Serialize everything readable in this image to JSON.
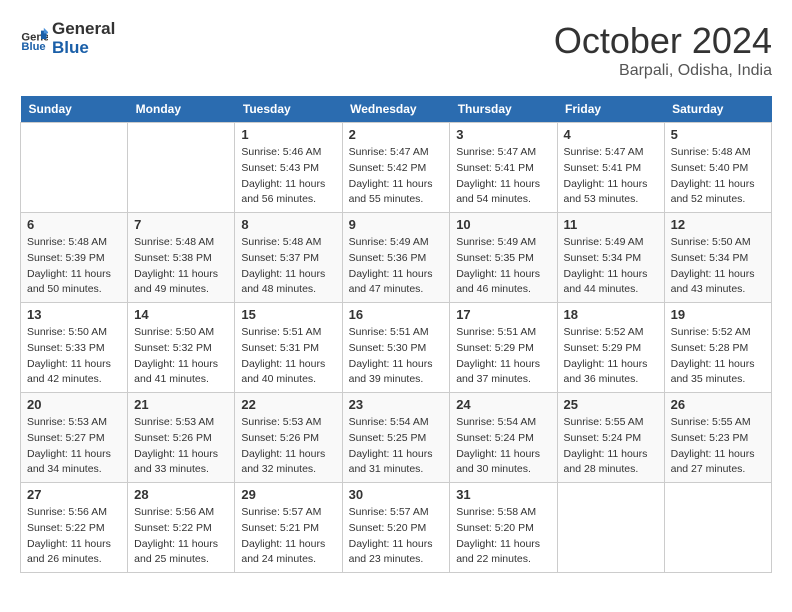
{
  "logo": {
    "line1": "General",
    "line2": "Blue"
  },
  "title": "October 2024",
  "location": "Barpali, Odisha, India",
  "days_of_week": [
    "Sunday",
    "Monday",
    "Tuesday",
    "Wednesday",
    "Thursday",
    "Friday",
    "Saturday"
  ],
  "weeks": [
    [
      {
        "day": "",
        "sunrise": "",
        "sunset": "",
        "daylight": ""
      },
      {
        "day": "",
        "sunrise": "",
        "sunset": "",
        "daylight": ""
      },
      {
        "day": "1",
        "sunrise": "Sunrise: 5:46 AM",
        "sunset": "Sunset: 5:43 PM",
        "daylight": "Daylight: 11 hours and 56 minutes."
      },
      {
        "day": "2",
        "sunrise": "Sunrise: 5:47 AM",
        "sunset": "Sunset: 5:42 PM",
        "daylight": "Daylight: 11 hours and 55 minutes."
      },
      {
        "day": "3",
        "sunrise": "Sunrise: 5:47 AM",
        "sunset": "Sunset: 5:41 PM",
        "daylight": "Daylight: 11 hours and 54 minutes."
      },
      {
        "day": "4",
        "sunrise": "Sunrise: 5:47 AM",
        "sunset": "Sunset: 5:41 PM",
        "daylight": "Daylight: 11 hours and 53 minutes."
      },
      {
        "day": "5",
        "sunrise": "Sunrise: 5:48 AM",
        "sunset": "Sunset: 5:40 PM",
        "daylight": "Daylight: 11 hours and 52 minutes."
      }
    ],
    [
      {
        "day": "6",
        "sunrise": "Sunrise: 5:48 AM",
        "sunset": "Sunset: 5:39 PM",
        "daylight": "Daylight: 11 hours and 50 minutes."
      },
      {
        "day": "7",
        "sunrise": "Sunrise: 5:48 AM",
        "sunset": "Sunset: 5:38 PM",
        "daylight": "Daylight: 11 hours and 49 minutes."
      },
      {
        "day": "8",
        "sunrise": "Sunrise: 5:48 AM",
        "sunset": "Sunset: 5:37 PM",
        "daylight": "Daylight: 11 hours and 48 minutes."
      },
      {
        "day": "9",
        "sunrise": "Sunrise: 5:49 AM",
        "sunset": "Sunset: 5:36 PM",
        "daylight": "Daylight: 11 hours and 47 minutes."
      },
      {
        "day": "10",
        "sunrise": "Sunrise: 5:49 AM",
        "sunset": "Sunset: 5:35 PM",
        "daylight": "Daylight: 11 hours and 46 minutes."
      },
      {
        "day": "11",
        "sunrise": "Sunrise: 5:49 AM",
        "sunset": "Sunset: 5:34 PM",
        "daylight": "Daylight: 11 hours and 44 minutes."
      },
      {
        "day": "12",
        "sunrise": "Sunrise: 5:50 AM",
        "sunset": "Sunset: 5:34 PM",
        "daylight": "Daylight: 11 hours and 43 minutes."
      }
    ],
    [
      {
        "day": "13",
        "sunrise": "Sunrise: 5:50 AM",
        "sunset": "Sunset: 5:33 PM",
        "daylight": "Daylight: 11 hours and 42 minutes."
      },
      {
        "day": "14",
        "sunrise": "Sunrise: 5:50 AM",
        "sunset": "Sunset: 5:32 PM",
        "daylight": "Daylight: 11 hours and 41 minutes."
      },
      {
        "day": "15",
        "sunrise": "Sunrise: 5:51 AM",
        "sunset": "Sunset: 5:31 PM",
        "daylight": "Daylight: 11 hours and 40 minutes."
      },
      {
        "day": "16",
        "sunrise": "Sunrise: 5:51 AM",
        "sunset": "Sunset: 5:30 PM",
        "daylight": "Daylight: 11 hours and 39 minutes."
      },
      {
        "day": "17",
        "sunrise": "Sunrise: 5:51 AM",
        "sunset": "Sunset: 5:29 PM",
        "daylight": "Daylight: 11 hours and 37 minutes."
      },
      {
        "day": "18",
        "sunrise": "Sunrise: 5:52 AM",
        "sunset": "Sunset: 5:29 PM",
        "daylight": "Daylight: 11 hours and 36 minutes."
      },
      {
        "day": "19",
        "sunrise": "Sunrise: 5:52 AM",
        "sunset": "Sunset: 5:28 PM",
        "daylight": "Daylight: 11 hours and 35 minutes."
      }
    ],
    [
      {
        "day": "20",
        "sunrise": "Sunrise: 5:53 AM",
        "sunset": "Sunset: 5:27 PM",
        "daylight": "Daylight: 11 hours and 34 minutes."
      },
      {
        "day": "21",
        "sunrise": "Sunrise: 5:53 AM",
        "sunset": "Sunset: 5:26 PM",
        "daylight": "Daylight: 11 hours and 33 minutes."
      },
      {
        "day": "22",
        "sunrise": "Sunrise: 5:53 AM",
        "sunset": "Sunset: 5:26 PM",
        "daylight": "Daylight: 11 hours and 32 minutes."
      },
      {
        "day": "23",
        "sunrise": "Sunrise: 5:54 AM",
        "sunset": "Sunset: 5:25 PM",
        "daylight": "Daylight: 11 hours and 31 minutes."
      },
      {
        "day": "24",
        "sunrise": "Sunrise: 5:54 AM",
        "sunset": "Sunset: 5:24 PM",
        "daylight": "Daylight: 11 hours and 30 minutes."
      },
      {
        "day": "25",
        "sunrise": "Sunrise: 5:55 AM",
        "sunset": "Sunset: 5:24 PM",
        "daylight": "Daylight: 11 hours and 28 minutes."
      },
      {
        "day": "26",
        "sunrise": "Sunrise: 5:55 AM",
        "sunset": "Sunset: 5:23 PM",
        "daylight": "Daylight: 11 hours and 27 minutes."
      }
    ],
    [
      {
        "day": "27",
        "sunrise": "Sunrise: 5:56 AM",
        "sunset": "Sunset: 5:22 PM",
        "daylight": "Daylight: 11 hours and 26 minutes."
      },
      {
        "day": "28",
        "sunrise": "Sunrise: 5:56 AM",
        "sunset": "Sunset: 5:22 PM",
        "daylight": "Daylight: 11 hours and 25 minutes."
      },
      {
        "day": "29",
        "sunrise": "Sunrise: 5:57 AM",
        "sunset": "Sunset: 5:21 PM",
        "daylight": "Daylight: 11 hours and 24 minutes."
      },
      {
        "day": "30",
        "sunrise": "Sunrise: 5:57 AM",
        "sunset": "Sunset: 5:20 PM",
        "daylight": "Daylight: 11 hours and 23 minutes."
      },
      {
        "day": "31",
        "sunrise": "Sunrise: 5:58 AM",
        "sunset": "Sunset: 5:20 PM",
        "daylight": "Daylight: 11 hours and 22 minutes."
      },
      {
        "day": "",
        "sunrise": "",
        "sunset": "",
        "daylight": ""
      },
      {
        "day": "",
        "sunrise": "",
        "sunset": "",
        "daylight": ""
      }
    ]
  ]
}
